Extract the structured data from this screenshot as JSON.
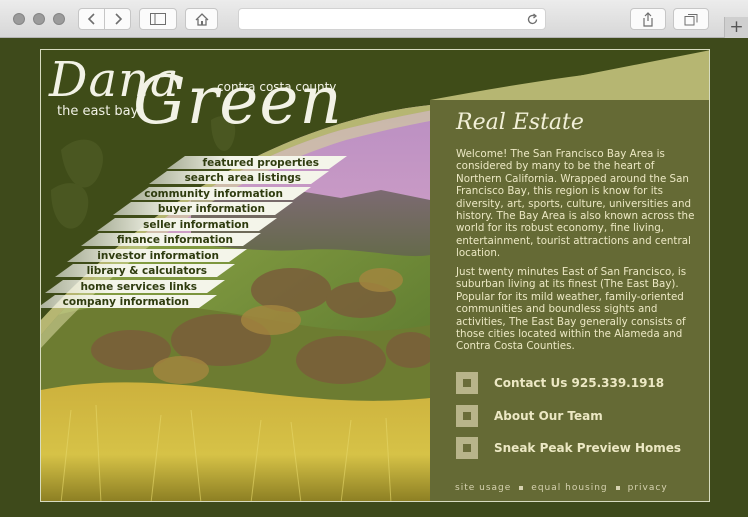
{
  "browser": {
    "back_icon": "chevron-left-icon",
    "forward_icon": "chevron-right-icon",
    "sidebar_icon": "sidebar-icon",
    "home_icon": "home-icon",
    "reload_icon": "reload-icon",
    "share_icon": "share-icon",
    "tabs_icon": "tabs-icon",
    "new_tab_label": "+"
  },
  "logo": {
    "dana": "Dana",
    "green": "Green",
    "east_bay": "the east bay",
    "county": "contra costa county"
  },
  "nav": {
    "items": [
      "featured properties",
      "search area listings",
      "community information",
      "buyer information",
      "seller information",
      "finance information",
      "investor information",
      "library & calculators",
      "home services links",
      "company information"
    ]
  },
  "panel": {
    "title": "Real Estate",
    "paragraph1": "Welcome! The San Francisco Bay Area is considered by many to be the heart of Northern California.  Wrapped around the San Francisco Bay, this region is know for its diversity, art, sports, culture, universities and history.  The Bay Area is also known across the world for its robust economy, fine living, entertainment, tourist attractions and central location.",
    "paragraph2": "Just twenty minutes East of San Francisco, is suburban living at its finest (The East Bay).   Popular for its mild weather, family-oriented communities and boundless sights and activities, The East Bay generally consists of those cities located within the Alameda and Contra Costa Counties."
  },
  "cta": {
    "contact": "Contact Us 925.339.1918",
    "team": "About Our Team",
    "preview": "Sneak Peak Preview Homes"
  },
  "footer": {
    "site_usage": "site usage",
    "equal_housing": "equal housing",
    "privacy": "privacy"
  },
  "colors": {
    "outer_bg": "#3e4a1b",
    "panel_bg": "#656a35",
    "swoosh": "#b6b672",
    "text_light": "#ece8c4"
  }
}
